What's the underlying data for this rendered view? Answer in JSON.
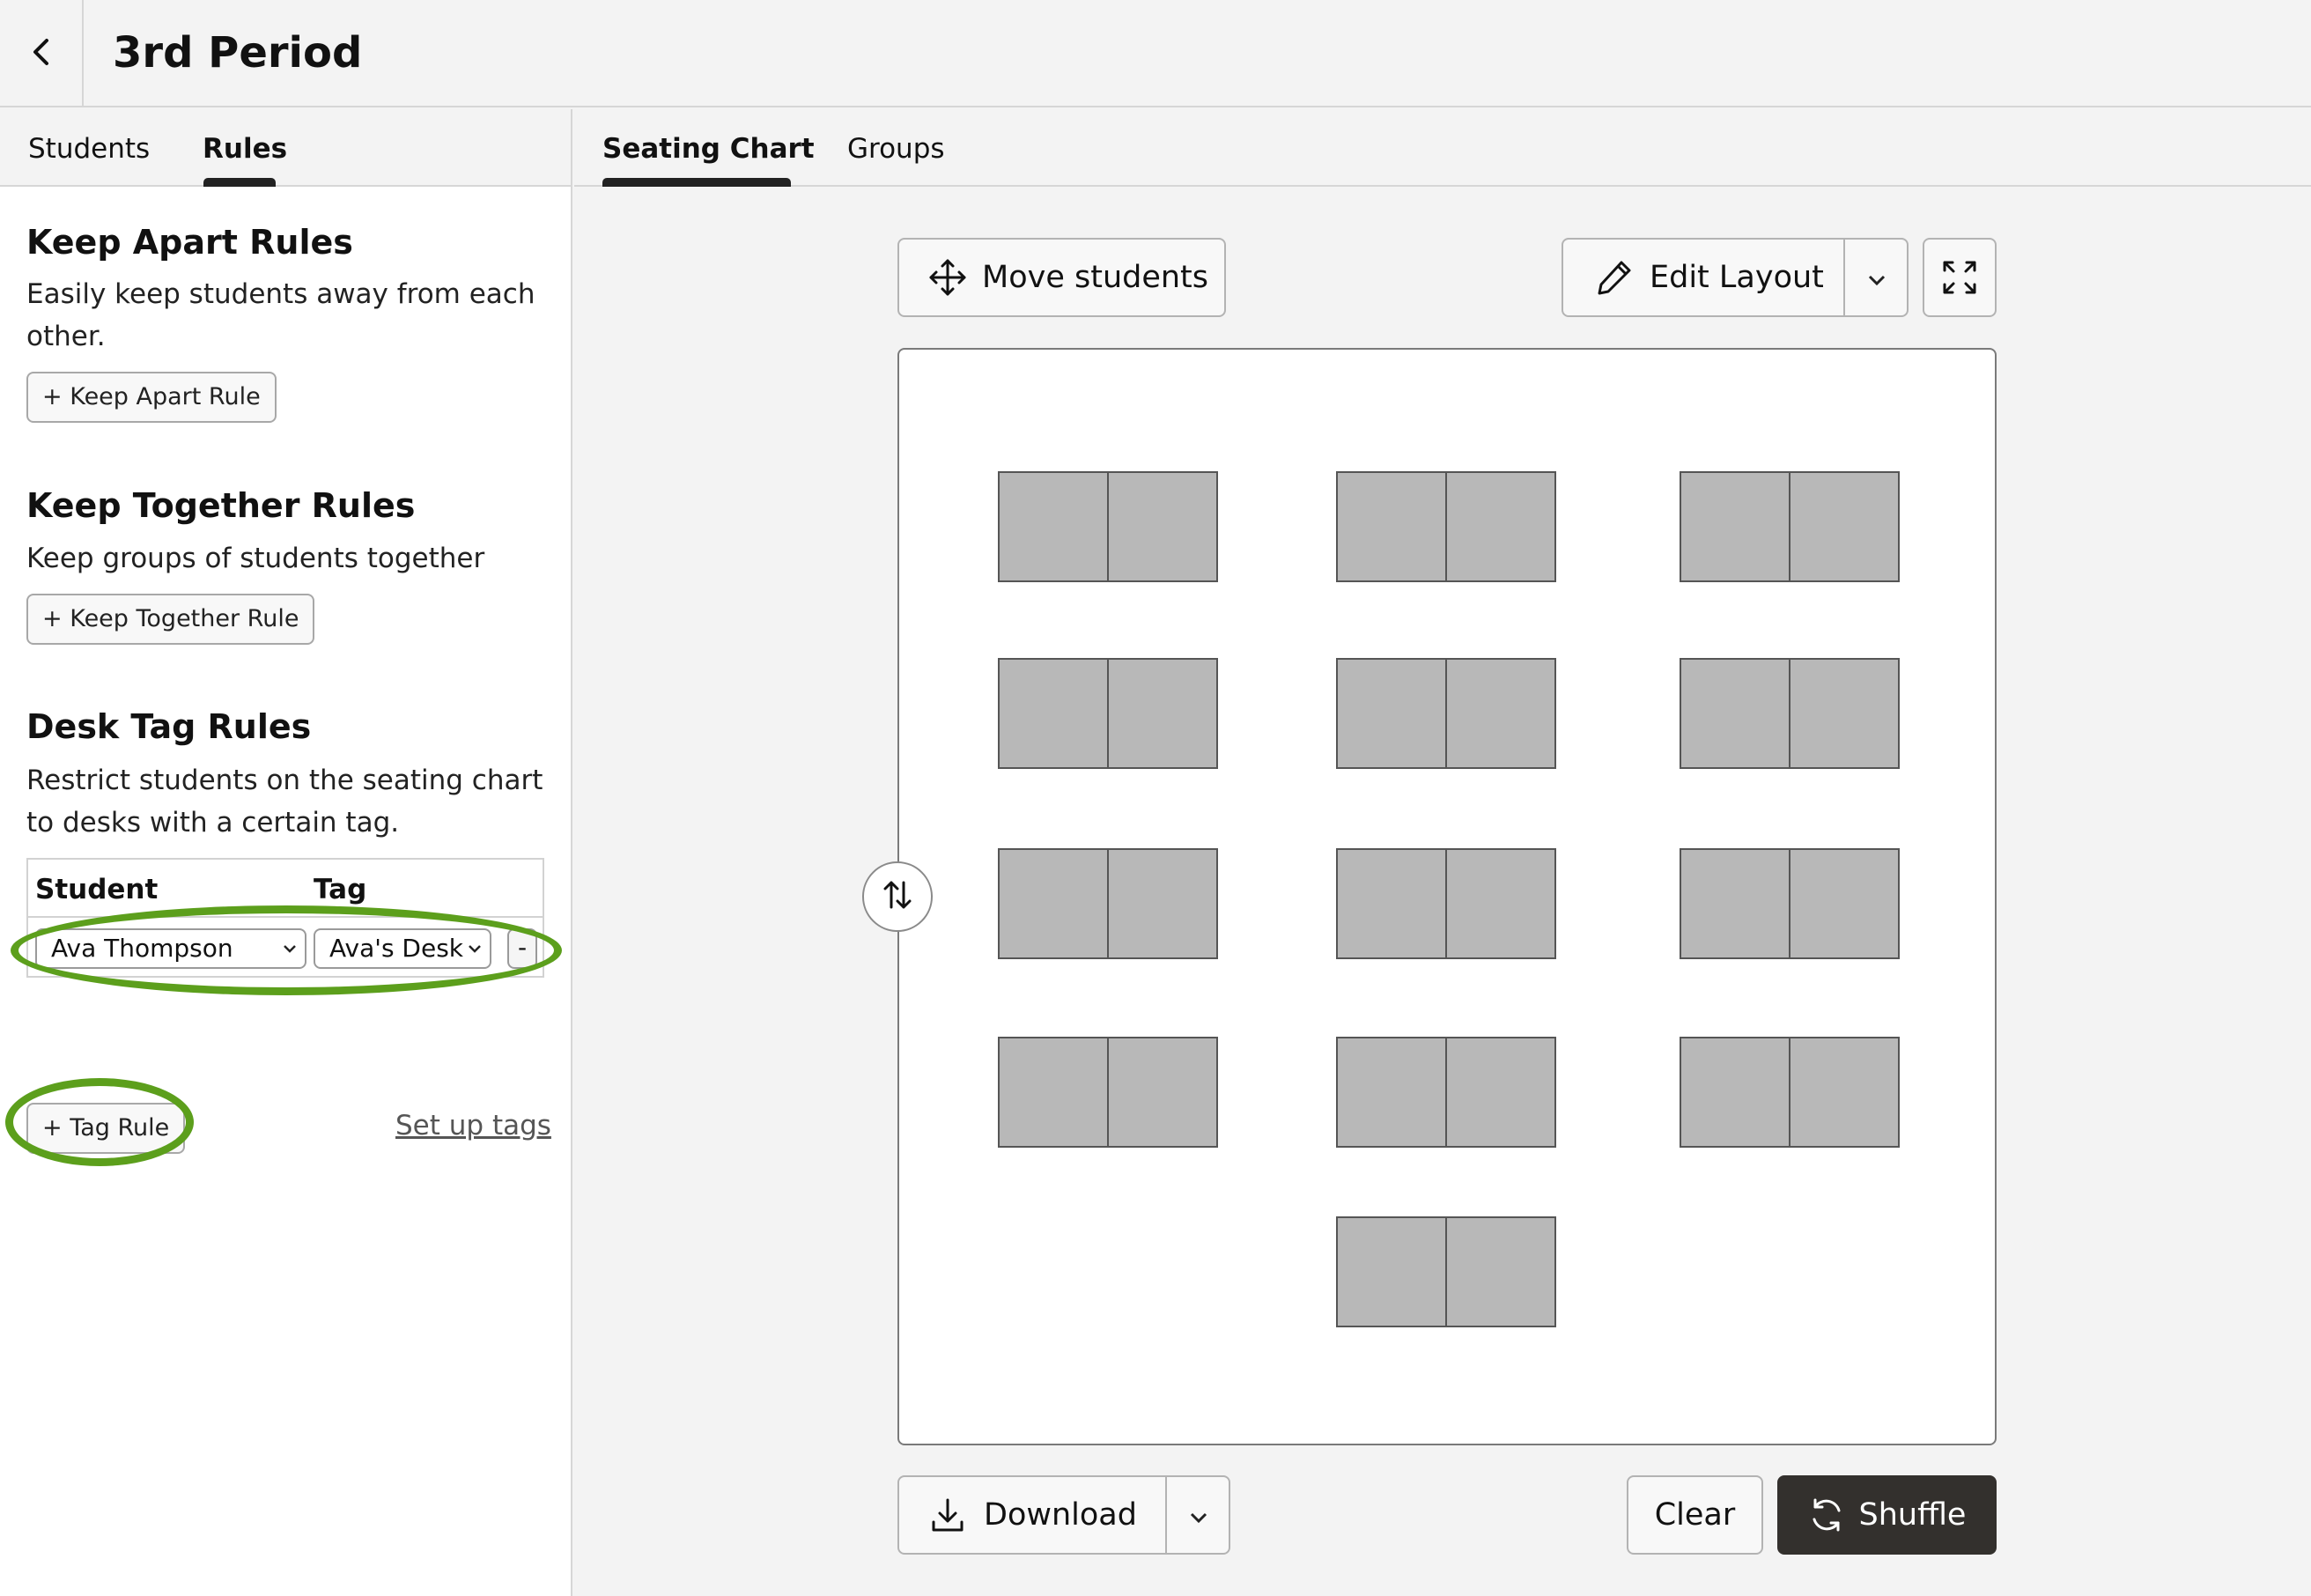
{
  "header": {
    "title": "3rd Period"
  },
  "left_tabs": [
    {
      "label": "Students"
    },
    {
      "label": "Rules"
    }
  ],
  "keep_apart": {
    "title": "Keep Apart Rules",
    "desc": "Easily keep students away from each other.",
    "button": "+ Keep Apart Rule"
  },
  "keep_together": {
    "title": "Keep Together Rules",
    "desc": "Keep groups of students together",
    "button": "+ Keep Together Rule"
  },
  "desk_tag": {
    "title": "Desk Tag Rules",
    "desc": "Restrict students on the seating chart to desks with a certain tag.",
    "col_student": "Student",
    "col_tag": "Tag",
    "row_student": "Ava Thompson",
    "row_tag": "Ava's Desk",
    "remove": "-",
    "add_button": "+ Tag Rule",
    "setup_link": "Set up tags"
  },
  "right_tabs": [
    {
      "label": "Seating Chart"
    },
    {
      "label": "Groups"
    }
  ],
  "toolbar": {
    "move": "Move students",
    "edit_layout": "Edit Layout"
  },
  "footer": {
    "download": "Download",
    "clear": "Clear",
    "shuffle": "Shuffle"
  },
  "colors": {
    "highlight": "#5c9f1c",
    "seat": "#b8b8b8",
    "shuffle_bg": "#33302d"
  }
}
